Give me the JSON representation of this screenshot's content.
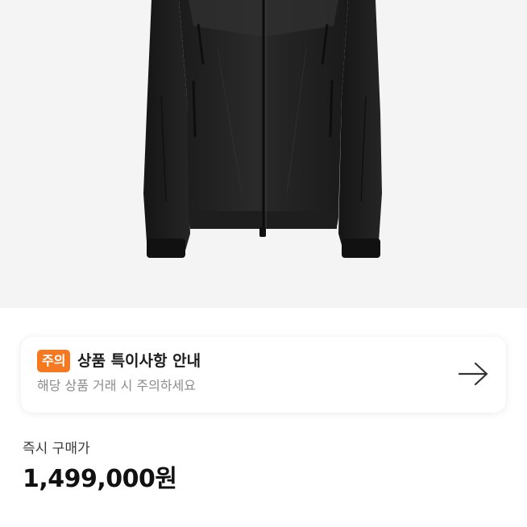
{
  "product": {
    "image_icon": "black-zip-jacket-image"
  },
  "notice": {
    "badge": "주의",
    "title": "상품 특이사항 안내",
    "subtitle": "해당 상품 거래 시 주의하세요",
    "arrow_icon": "arrow-right-icon",
    "badge_color": "#f47920"
  },
  "price": {
    "label": "즉시 구매가",
    "value": "1,499,000원"
  }
}
